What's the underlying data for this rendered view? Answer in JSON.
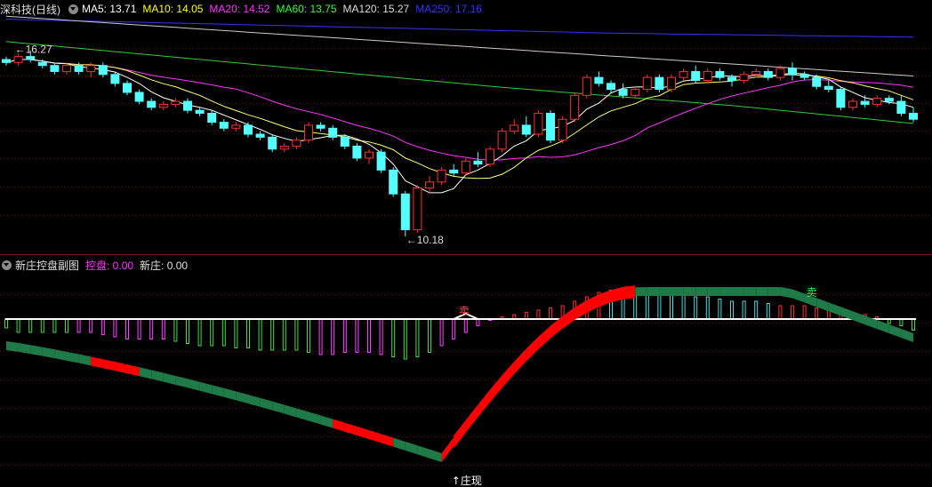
{
  "main_panel": {
    "title": "深科技(日线)",
    "ma_labels": [
      {
        "name": "MA5",
        "text": "MA5: 13.71",
        "color": "#ffffff"
      },
      {
        "name": "MA10",
        "text": "MA10: 14.05",
        "color": "#ffff00"
      },
      {
        "name": "MA20",
        "text": "MA20: 14.52",
        "color": "#ff33ff"
      },
      {
        "name": "MA60",
        "text": "MA60: 13.75",
        "color": "#33ff33"
      },
      {
        "name": "MA120",
        "text": "MA120: 15.27",
        "color": "#dddddd"
      },
      {
        "name": "MA250",
        "text": "MA250: 17.16",
        "color": "#3333ff"
      }
    ],
    "high_marker": "←16.27",
    "low_marker": "←10.18",
    "candles": [
      [
        16.1,
        16.2,
        15.9,
        16.0
      ],
      [
        16.0,
        16.3,
        15.9,
        16.2
      ],
      [
        16.2,
        16.4,
        16.0,
        16.1
      ],
      [
        16.0,
        16.1,
        15.8,
        15.9
      ],
      [
        15.9,
        16.0,
        15.6,
        15.7
      ],
      [
        15.7,
        16.0,
        15.6,
        15.9
      ],
      [
        15.9,
        16.0,
        15.6,
        15.7
      ],
      [
        15.7,
        16.0,
        15.5,
        15.9
      ],
      [
        15.9,
        16.0,
        15.5,
        15.6
      ],
      [
        15.6,
        15.7,
        15.2,
        15.3
      ],
      [
        15.3,
        15.4,
        14.9,
        15.0
      ],
      [
        15.0,
        15.1,
        14.6,
        14.7
      ],
      [
        14.7,
        14.8,
        14.4,
        14.5
      ],
      [
        14.5,
        14.7,
        14.4,
        14.6
      ],
      [
        14.6,
        14.8,
        14.5,
        14.7
      ],
      [
        14.7,
        14.8,
        14.3,
        14.4
      ],
      [
        14.4,
        14.5,
        14.2,
        14.3
      ],
      [
        14.3,
        14.4,
        13.9,
        14.0
      ],
      [
        14.0,
        14.1,
        13.7,
        13.8
      ],
      [
        13.8,
        14.0,
        13.7,
        13.9
      ],
      [
        13.9,
        14.0,
        13.5,
        13.6
      ],
      [
        13.6,
        13.7,
        13.4,
        13.5
      ],
      [
        13.5,
        13.6,
        13.0,
        13.1
      ],
      [
        13.1,
        13.3,
        13.0,
        13.2
      ],
      [
        13.2,
        13.5,
        13.1,
        13.4
      ],
      [
        13.4,
        14.0,
        13.3,
        13.9
      ],
      [
        13.9,
        14.0,
        13.7,
        13.8
      ],
      [
        13.8,
        13.9,
        13.4,
        13.5
      ],
      [
        13.5,
        13.6,
        13.1,
        13.2
      ],
      [
        13.2,
        13.3,
        12.7,
        12.8
      ],
      [
        12.8,
        13.1,
        12.6,
        13.0
      ],
      [
        13.0,
        13.1,
        12.3,
        12.4
      ],
      [
        12.4,
        12.5,
        11.5,
        11.6
      ],
      [
        11.6,
        11.7,
        10.18,
        10.4
      ],
      [
        10.4,
        11.9,
        10.3,
        11.8
      ],
      [
        11.8,
        12.2,
        11.6,
        12.0
      ],
      [
        12.0,
        12.5,
        11.9,
        12.4
      ],
      [
        12.4,
        12.6,
        12.2,
        12.3
      ],
      [
        12.3,
        12.8,
        12.2,
        12.7
      ],
      [
        12.7,
        13.0,
        12.5,
        12.6
      ],
      [
        12.6,
        13.2,
        12.5,
        13.1
      ],
      [
        13.1,
        13.8,
        13.0,
        13.7
      ],
      [
        13.7,
        14.1,
        13.6,
        13.9
      ],
      [
        13.9,
        14.2,
        13.5,
        13.6
      ],
      [
        13.6,
        14.4,
        13.5,
        14.3
      ],
      [
        14.3,
        14.4,
        13.3,
        13.4
      ],
      [
        13.4,
        14.2,
        13.3,
        14.1
      ],
      [
        14.1,
        15.0,
        14.0,
        14.9
      ],
      [
        14.9,
        15.6,
        14.8,
        15.5
      ],
      [
        15.5,
        15.7,
        15.2,
        15.3
      ],
      [
        15.3,
        15.4,
        15.0,
        15.1
      ],
      [
        15.1,
        15.3,
        14.8,
        14.9
      ],
      [
        14.9,
        15.2,
        14.8,
        15.1
      ],
      [
        15.1,
        15.6,
        15.0,
        15.5
      ],
      [
        15.5,
        15.6,
        15.0,
        15.1
      ],
      [
        15.1,
        15.6,
        15.0,
        15.5
      ],
      [
        15.5,
        15.8,
        15.4,
        15.7
      ],
      [
        15.7,
        15.9,
        15.3,
        15.4
      ],
      [
        15.4,
        15.8,
        15.3,
        15.7
      ],
      [
        15.7,
        15.8,
        15.4,
        15.5
      ],
      [
        15.5,
        15.6,
        15.2,
        15.4
      ],
      [
        15.4,
        15.7,
        15.3,
        15.6
      ],
      [
        15.6,
        15.8,
        15.5,
        15.7
      ],
      [
        15.7,
        15.8,
        15.4,
        15.5
      ],
      [
        15.5,
        15.9,
        15.4,
        15.8
      ],
      [
        15.8,
        16.0,
        15.4,
        15.6
      ],
      [
        15.6,
        15.7,
        15.4,
        15.5
      ],
      [
        15.5,
        15.6,
        15.1,
        15.2
      ],
      [
        15.2,
        15.4,
        15.0,
        15.1
      ],
      [
        15.1,
        15.2,
        14.4,
        14.5
      ],
      [
        14.5,
        14.8,
        14.4,
        14.7
      ],
      [
        14.7,
        14.9,
        14.5,
        14.6
      ],
      [
        14.6,
        14.9,
        14.5,
        14.8
      ],
      [
        14.8,
        14.9,
        14.6,
        14.7
      ],
      [
        14.7,
        14.9,
        14.2,
        14.3
      ],
      [
        14.3,
        14.5,
        14.0,
        14.1
      ]
    ]
  },
  "sub_panel": {
    "title": "新庄控盘副图",
    "kongpan_label": "控盘: 0.00",
    "xinzhuang_label": "新庄: 0.00",
    "markers": [
      "卖",
      "↑庄现",
      "卖"
    ],
    "bars": [
      -2,
      -3,
      -3,
      -3,
      -3,
      -3,
      -3,
      -3,
      -3.5,
      -4,
      -4.5,
      -4.5,
      -4.5,
      -4.5,
      -5,
      -5.5,
      -6,
      -6,
      -6,
      -6.5,
      -6.5,
      -7,
      -7,
      -7,
      -7,
      -7.5,
      -8,
      -8,
      -7.5,
      -7.5,
      -7.5,
      -8,
      -8.5,
      -9,
      -8.5,
      -7.5,
      -6,
      -4.5,
      -3,
      -1.5,
      -0.3,
      0.5,
      1,
      1.5,
      2,
      2.5,
      3,
      4,
      5,
      6,
      6.5,
      6.5,
      6.5,
      6,
      6,
      6,
      5.5,
      5,
      5,
      4.5,
      4,
      4,
      4,
      3.5,
      3,
      3,
      3,
      2.5,
      2.5,
      2,
      1.5,
      1,
      0.5,
      -1,
      -1.5,
      -2.5
    ],
    "band_colors": {
      "up": "#ff0000",
      "down": "#1e7a46"
    }
  },
  "colors": {
    "up": "#ff3030",
    "down": "#54ffff",
    "separator": "#7a1010"
  }
}
